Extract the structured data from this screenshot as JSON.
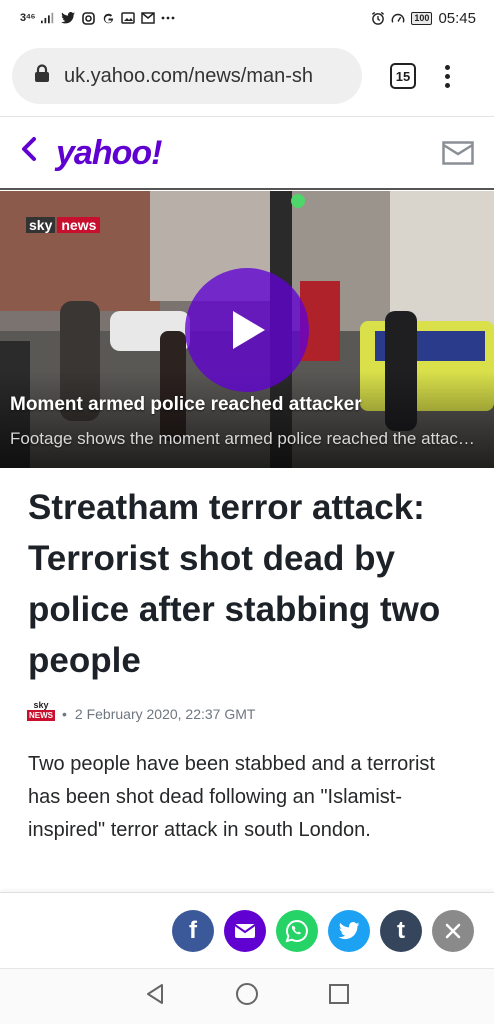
{
  "status_bar": {
    "network": "3⁴⁶",
    "battery": "100",
    "time": "05:45"
  },
  "browser": {
    "url": "uk.yahoo.com/news/man-sh",
    "tab_count": "15"
  },
  "header": {
    "logo": "yahoo!"
  },
  "video": {
    "channel_sky": "sky",
    "channel_news": "news",
    "title": "Moment armed police reached attacker",
    "subtitle": "Footage shows the moment armed police reached the attacker"
  },
  "article": {
    "headline": "Streatham terror attack: Terrorist shot dead by police after stabbing two people",
    "source_logo_top": "sky",
    "source_logo_bottom": "NEWS",
    "date": "2 February 2020, 22:37 GMT",
    "separator": "•",
    "body": "Two people have been stabbed and a terrorist has been shot dead following an \"Islamist-inspired\" terror attack in south London."
  },
  "share": {
    "facebook_label": "f",
    "tumblr_label": "t",
    "colors": {
      "facebook": "#3b5998",
      "mail": "#6001d2",
      "whatsapp": "#25d366",
      "twitter": "#1da1f2",
      "tumblr": "#35465c",
      "close": "#8a8a8a"
    }
  },
  "theme": {
    "accent": "#6001d2"
  },
  "icons": {
    "status_left": [
      "signal-icon",
      "twitter-icon",
      "instagram-icon",
      "google-icon",
      "gallery-icon",
      "mail-icon",
      "more-icon"
    ],
    "status_right": [
      "alarm-icon",
      "speed-icon",
      "battery-icon"
    ],
    "nav": [
      "back-triangle-icon",
      "home-circle-icon",
      "recents-square-icon"
    ]
  }
}
